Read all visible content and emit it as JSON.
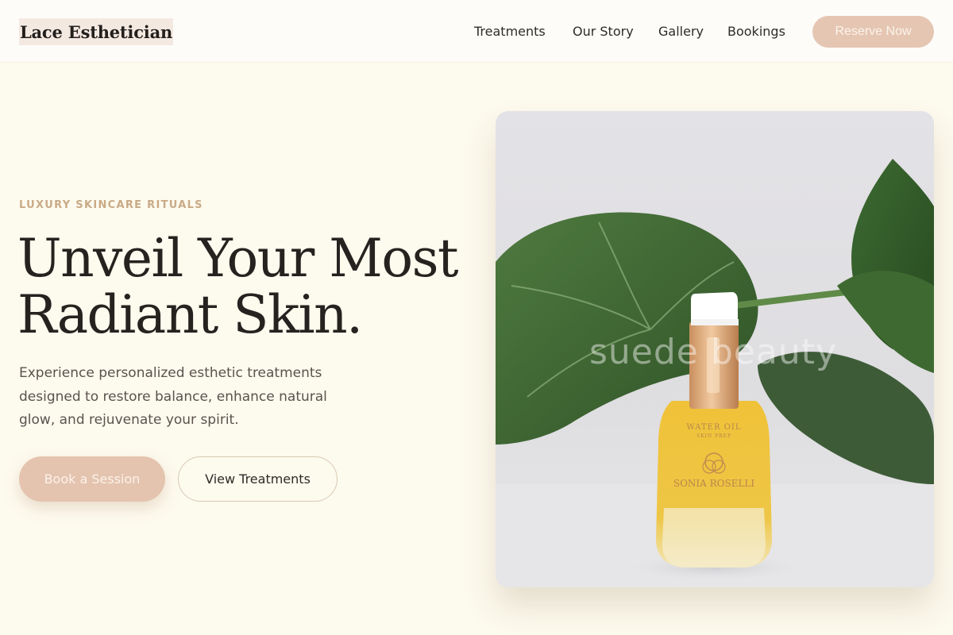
{
  "brand": {
    "name": "Lace Esthetician"
  },
  "nav": {
    "links": [
      {
        "label": "Treatments"
      },
      {
        "label": "Our Story"
      },
      {
        "label": "Gallery"
      },
      {
        "label": "Bookings"
      }
    ],
    "cta_label": "Reserve Now"
  },
  "hero": {
    "eyebrow": "LUXURY SKINCARE RITUALS",
    "headline_line1": "Unveil Your Most",
    "headline_line2": "Radiant Skin.",
    "subtext": "Experience personalized esthetic treatments designed to restore balance, enhance natural glow, and rejuvenate your spirit.",
    "primary_button": "Book a Session",
    "secondary_button": "View Treatments"
  },
  "image": {
    "watermark": "suede beauty",
    "bottle_label_line1": "WATER OIL",
    "bottle_label_line2": "SKIN PREP",
    "bottle_brand": "SONIA ROSELLI"
  },
  "colors": {
    "background": "#fdfaee",
    "accent": "#e5c6b2",
    "eyebrow": "#c9aa86",
    "text_dark": "#26221f"
  }
}
